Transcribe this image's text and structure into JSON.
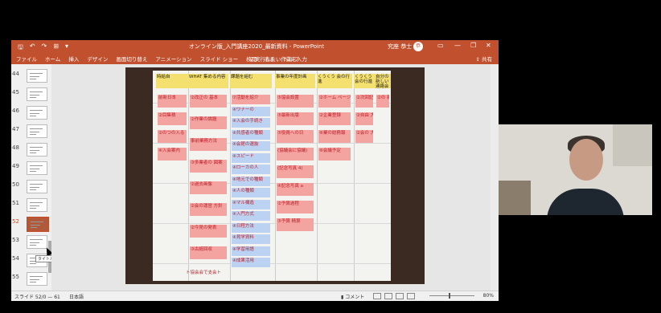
{
  "window": {
    "title": "オンライン版_入門講座2020_最新資料 - PowerPoint",
    "user_name": "究座 恭士",
    "user_initial": "恭",
    "controls": [
      "▭",
      "—",
      "❐",
      "✕"
    ],
    "quick_access": [
      "🖫",
      "↶",
      "↷",
      "⊞",
      "▾"
    ]
  },
  "ribbon": {
    "tabs": [
      "ファイル",
      "ホーム",
      "挿入",
      "デザイン",
      "画面切り替え",
      "アニメーション",
      "スライド ショー",
      "校閲",
      "表示",
      "ヘルプ"
    ],
    "tell_me": "実行したい作業を入力",
    "share": "共有"
  },
  "thumbnails": [
    {
      "num": "44"
    },
    {
      "num": "45"
    },
    {
      "num": "46"
    },
    {
      "num": "47"
    },
    {
      "num": "48"
    },
    {
      "num": "49"
    },
    {
      "num": "50"
    },
    {
      "num": "51"
    },
    {
      "num": "52"
    },
    {
      "num": "53"
    },
    {
      "num": "54"
    },
    {
      "num": "55"
    }
  ],
  "selected_thumb": "52",
  "tooltip": "タイトル スライド",
  "board": {
    "columns": [
      {
        "header": "時給自",
        "notes": [
          {
            "t": "前新日本",
            "c": "p"
          },
          {
            "t": "②目集積",
            "c": "p"
          },
          {
            "t": "②のつの入る",
            "c": "p"
          },
          {
            "t": "④入会案内",
            "c": "p"
          }
        ]
      },
      {
        "header": "WHAT 集める内容",
        "notes": [
          {
            "t": "②改正の 基本",
            "c": "p"
          },
          {
            "t": "②作業の論題",
            "c": "p"
          },
          {
            "t": "事前業務方法",
            "c": "p"
          },
          {
            "t": "③多業者の 図案",
            "c": "p"
          },
          {
            "t": "②過去画像",
            "c": "p"
          },
          {
            "t": "②会の運営 方針",
            "c": "p"
          },
          {
            "t": "②今見の発表",
            "c": "p"
          },
          {
            "t": "③古紙回収",
            "c": "p"
          }
        ]
      },
      {
        "header": "課題を組む",
        "notes": [
          {
            "t": "⑦活動を紹介",
            "c": "p"
          },
          {
            "t": "④ワナーの",
            "c": "b"
          },
          {
            "t": "④入会の手続き",
            "c": "b"
          },
          {
            "t": "④共感者の種類",
            "c": "b"
          },
          {
            "t": "④会館の選抜",
            "c": "b"
          },
          {
            "t": "④スピード",
            "c": "b"
          },
          {
            "t": "④ローカの人",
            "c": "b"
          },
          {
            "t": "④地元での種類",
            "c": "b"
          },
          {
            "t": "④人の種類",
            "c": "b"
          },
          {
            "t": "④マル構造",
            "c": "b"
          },
          {
            "t": "④入門方式",
            "c": "b"
          },
          {
            "t": "④日程方法",
            "c": "b"
          },
          {
            "t": "④見学資料",
            "c": "b"
          },
          {
            "t": "④学習用語",
            "c": "b"
          },
          {
            "t": "④成果活用",
            "c": "b"
          }
        ]
      },
      {
        "header": "事業の年度計画",
        "notes": [
          {
            "t": "⑤協会設置",
            "c": "p"
          },
          {
            "t": "⑤最新出版",
            "c": "p"
          },
          {
            "t": "⑤役員への日",
            "c": "p"
          },
          {
            "t": "(協議会に協議)",
            "c": "p"
          },
          {
            "t": "(記念写真 4)",
            "c": "p"
          },
          {
            "t": "④記念写真 a",
            "c": "p"
          },
          {
            "t": "②予算過程",
            "c": "p"
          },
          {
            "t": "⑤予算 精算",
            "c": "p"
          }
        ]
      },
      {
        "header": "くうくう 会の行進",
        "notes": [
          {
            "t": "②ホーム ページ",
            "c": "p"
          },
          {
            "t": "②企業登録",
            "c": "p"
          },
          {
            "t": "⑥業の総務報",
            "c": "p"
          },
          {
            "t": "⑥会議予定",
            "c": "p"
          }
        ]
      },
      {
        "header": "くうくう 会の行進",
        "notes": [
          {
            "t": "②次回記念",
            "c": "p"
          },
          {
            "t": "②自由 大会",
            "c": "p"
          },
          {
            "t": "②会の 大会",
            "c": "p"
          }
        ]
      },
      {
        "header": "自分の新しい 連絡会",
        "notes": [
          {
            "t": "②の 新会",
            "c": "p"
          }
        ]
      }
    ],
    "bottom_note": "ト協会会で支会ト"
  },
  "status": {
    "slide": "スライド 52/0 — 61",
    "language": "日本語",
    "comments": "コメント",
    "zoom": "80%"
  }
}
